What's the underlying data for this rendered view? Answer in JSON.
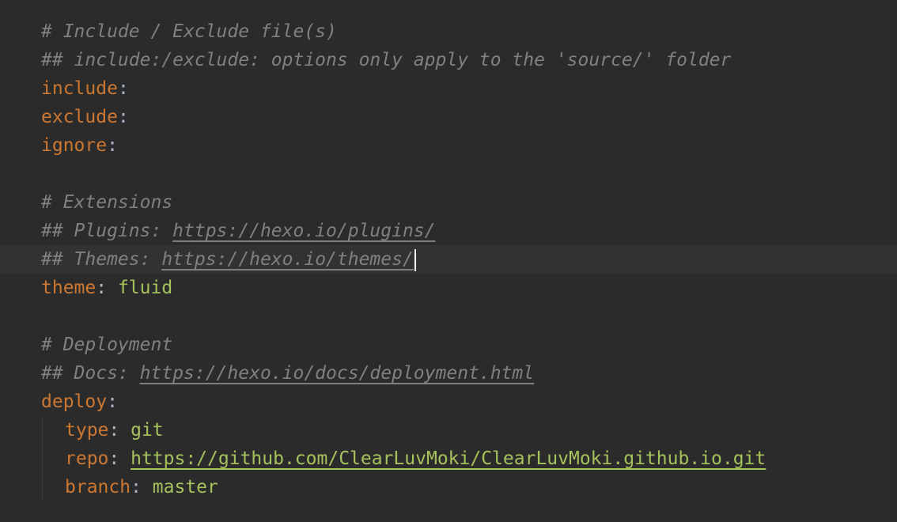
{
  "editor": {
    "lines": [
      {
        "type": "comment",
        "text": "# Include / Exclude file(s)"
      },
      {
        "type": "comment",
        "text": "## include:/exclude: options only apply to the 'source/' folder"
      },
      {
        "type": "kv",
        "key": "include",
        "colon": ":",
        "value": ""
      },
      {
        "type": "kv",
        "key": "exclude",
        "colon": ":",
        "value": ""
      },
      {
        "type": "kv",
        "key": "ignore",
        "colon": ":",
        "value": ""
      },
      {
        "type": "blank"
      },
      {
        "type": "comment",
        "text": "# Extensions"
      },
      {
        "type": "comment_url",
        "prefix": "## Plugins: ",
        "url": "https://hexo.io/plugins/"
      },
      {
        "type": "comment_url",
        "prefix": "## Themes: ",
        "url": "https://hexo.io/themes/"
      },
      {
        "type": "kv",
        "key": "theme",
        "colon": ": ",
        "value": "fluid"
      },
      {
        "type": "blank"
      },
      {
        "type": "comment",
        "text": "# Deployment"
      },
      {
        "type": "comment_url",
        "prefix": "## Docs: ",
        "url": "https://hexo.io/docs/deployment.html"
      },
      {
        "type": "kv",
        "key": "deploy",
        "colon": ":",
        "value": ""
      },
      {
        "type": "kv",
        "key": "type",
        "colon": ": ",
        "value": "git"
      },
      {
        "type": "kv_url",
        "key": "repo",
        "colon": ": ",
        "url": "https://github.com/ClearLuvMoki/ClearLuvMoki.github.io.git"
      },
      {
        "type": "kv",
        "key": "branch",
        "colon": ": ",
        "value": "master"
      }
    ]
  },
  "colors": {
    "background": "#2b2b2b",
    "current_line": "#323232",
    "comment": "#808080",
    "key": "#cc7832",
    "string_value": "#a5c25c",
    "caret": "#f5f5f5"
  }
}
